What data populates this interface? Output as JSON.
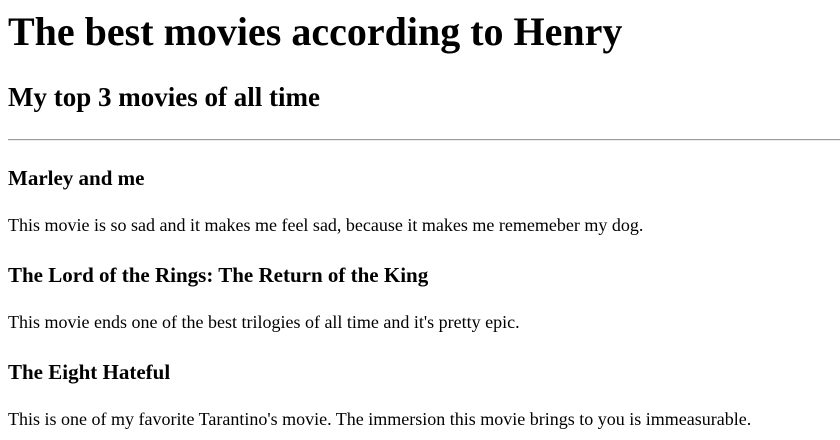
{
  "page": {
    "title": "The best movies according to Henry",
    "subtitle": "My top 3 movies of all time"
  },
  "movies": [
    {
      "title": "Marley and me",
      "description": "This movie is so sad and it makes me feel sad, because it makes me rememeber my dog."
    },
    {
      "title": "The Lord of the Rings: The Return of the King",
      "description": "This movie ends one of the best trilogies of all time and it's pretty epic."
    },
    {
      "title": "The Eight Hateful",
      "description": "This is one of my favorite Tarantino's movie. The immersion this movie brings to you is immeasurable."
    }
  ]
}
